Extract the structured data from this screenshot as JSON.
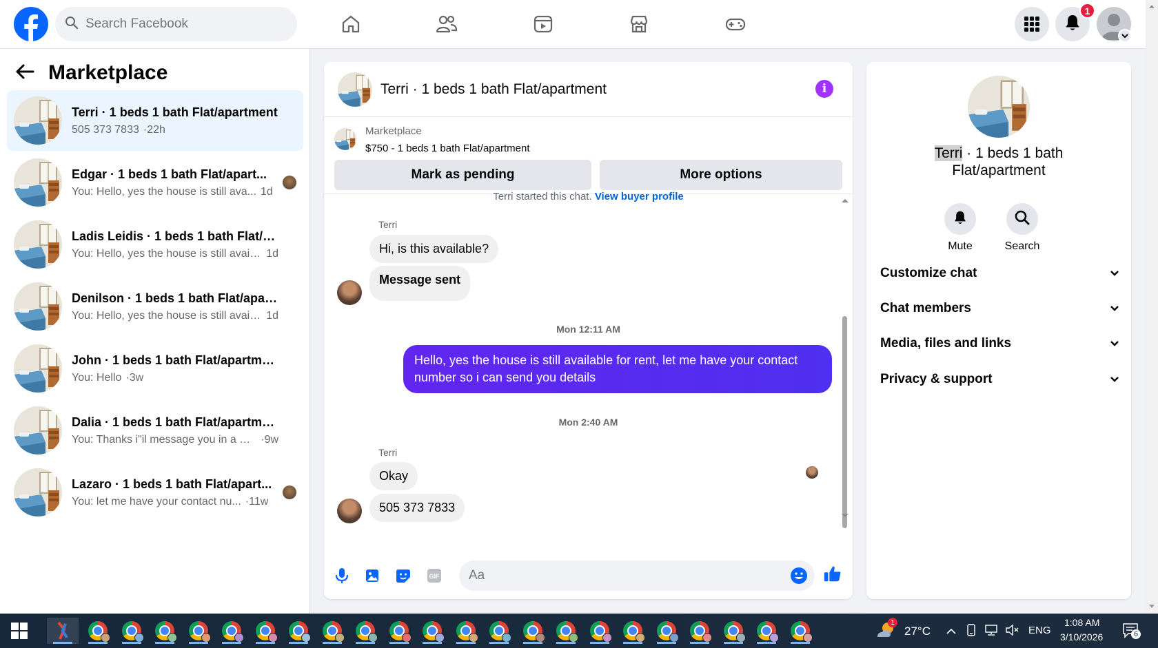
{
  "topnav": {
    "search_placeholder": "Search Facebook",
    "nav_icons": [
      "home-icon",
      "friends-icon",
      "video-icon",
      "marketplace-icon",
      "gaming-icon"
    ],
    "right_icons": [
      "menu-grid-icon",
      "notifications-icon",
      "account-icon"
    ],
    "notification_count": "1",
    "colors": {
      "brand": "#0866ff",
      "badge": "#e41e3f"
    }
  },
  "sidebar": {
    "title": "Marketplace",
    "conversations": [
      {
        "title": "Terri · 1 beds 1 bath Flat/apartment",
        "snippet": "505 373 7833",
        "time": "·22h",
        "active": true
      },
      {
        "title": "Edgar · 1 beds 1 bath Flat/apart...",
        "snippet": "You: Hello, yes the house is still ava...",
        "time": "1d"
      },
      {
        "title": "Ladis Leidis · 1 beds 1 bath Flat/ap...",
        "snippet": "You: Hello, yes the house is still availa...",
        "time": "1d"
      },
      {
        "title": "Denilson · 1 beds 1 bath Flat/apart...",
        "snippet": "You: Hello, yes the house is still availa...",
        "time": "1d"
      },
      {
        "title": "John · 1 beds 1 bath Flat/apartment",
        "snippet": "You: Hello",
        "time": "·3w"
      },
      {
        "title": "Dalia · 1 beds 1 bath Flat/apartment",
        "snippet": "You: Thanks i\"il message you in a mo...",
        "time": "·9w"
      },
      {
        "title": "Lazaro · 1 beds 1 bath Flat/apart...",
        "snippet": "You: let me have your contact nu...",
        "time": "·11w"
      }
    ]
  },
  "chat": {
    "title": "Terri · 1 beds 1 bath Flat/apartment",
    "listing_label": "Marketplace",
    "listing_price": "$750 - 1 beds 1 bath Flat/apartment",
    "mark_pending": "Mark as pending",
    "more_options": "More options",
    "started_text": "Terri started this chat.",
    "buyer_profile_link": "View buyer profile",
    "messages": {
      "sender1": "Terri",
      "in1": "Hi, is this available?",
      "in2": "Message sent",
      "time1": "Mon 12:11 AM",
      "out1": "Hello, yes the house is still available for rent, let me have your contact number so i can send you details",
      "time2": "Mon 2:40 AM",
      "sender2": "Terri",
      "in3": "Okay",
      "in4": "505 373 7833"
    },
    "composer_placeholder": "Aa",
    "composer_icons": [
      "microphone-icon",
      "photo-icon",
      "sticker-icon",
      "gif-icon",
      "emoji-icon",
      "thumbs-up-icon"
    ],
    "accent_color": "#5c1bf5"
  },
  "details": {
    "name_highlight": "Terri",
    "title_rest": " · 1 beds 1 bath",
    "title_line2": "Flat/apartment",
    "mute_label": "Mute",
    "search_label": "Search",
    "sections": [
      "Customize chat",
      "Chat members",
      "Media, files and links",
      "Privacy & support"
    ]
  },
  "taskbar": {
    "temperature": "27°C",
    "language": "ENG",
    "time": "1:08 AM",
    "date": "3/10/2026",
    "notification_count": "6",
    "weather_badge": "1"
  }
}
